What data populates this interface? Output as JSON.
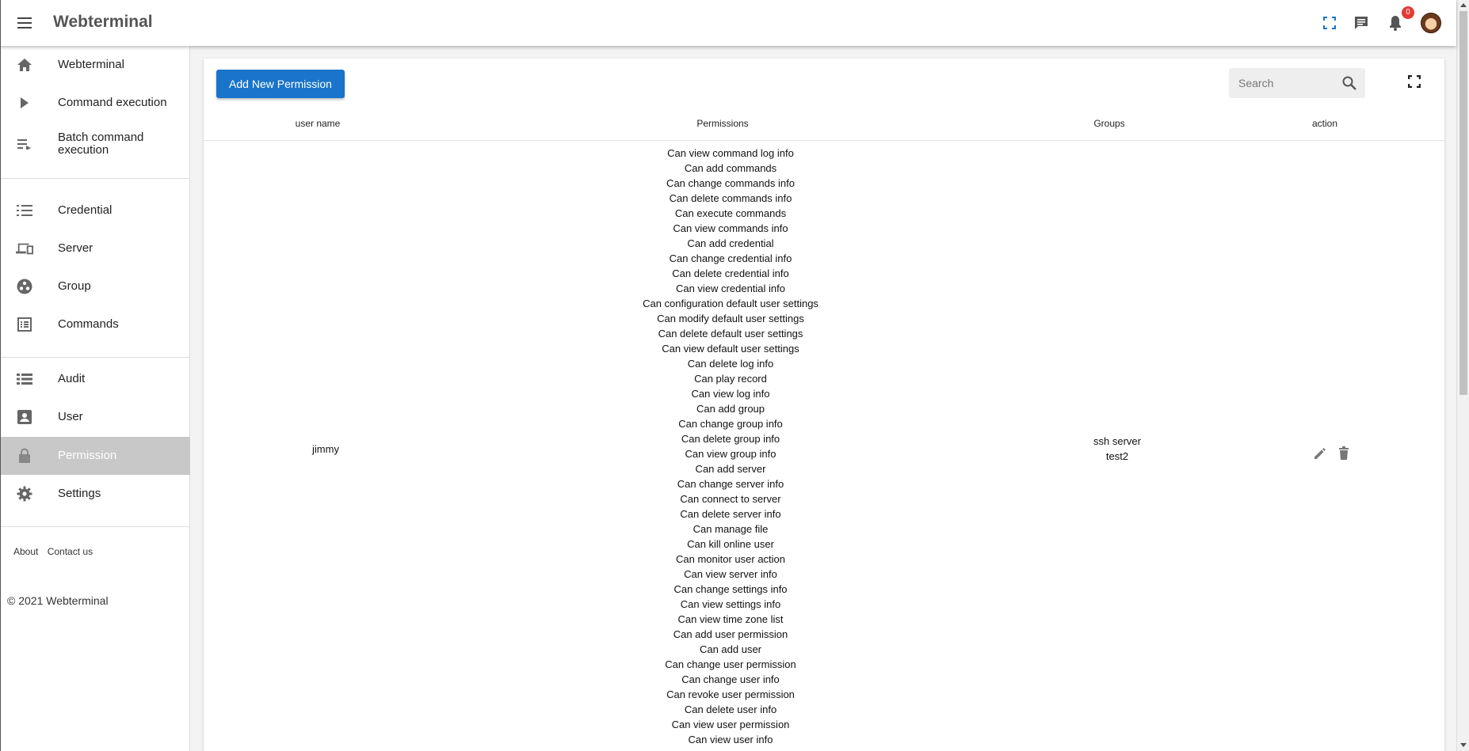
{
  "app": {
    "title": "Webterminal"
  },
  "topbar": {
    "notification_count": "0"
  },
  "sidebar": {
    "items": [
      {
        "label": "Webterminal",
        "icon": "home-icon"
      },
      {
        "label": "Command execution",
        "icon": "play-icon"
      },
      {
        "label": "Batch command execution",
        "icon": "playlist-icon"
      },
      {
        "label": "Credential",
        "icon": "list-numbered-icon"
      },
      {
        "label": "Server",
        "icon": "devices-icon"
      },
      {
        "label": "Group",
        "icon": "group-workspaces-icon"
      },
      {
        "label": "Commands",
        "icon": "list-alt-icon"
      },
      {
        "label": "Audit",
        "icon": "view-list-icon"
      },
      {
        "label": "User",
        "icon": "account-box-icon"
      },
      {
        "label": "Permission",
        "icon": "lock-icon",
        "active": true
      },
      {
        "label": "Settings",
        "icon": "gear-icon"
      }
    ],
    "footer_links": [
      "About",
      "Contact us"
    ],
    "copyright": "© 2021 Webterminal"
  },
  "toolbar": {
    "add_button_label": "Add New Permission",
    "search_placeholder": "Search"
  },
  "table": {
    "columns": [
      "user name",
      "Permissions",
      "Groups",
      "action"
    ],
    "rows": [
      {
        "user_name": "jimmy",
        "permissions": [
          "Can view command log info",
          "Can add commands",
          "Can change commands info",
          "Can delete commands info",
          "Can execute commands",
          "Can view commands info",
          "Can add credential",
          "Can change credential info",
          "Can delete credential info",
          "Can view credential info",
          "Can configuration default user settings",
          "Can modify default user settings",
          "Can delete default user settings",
          "Can view default user settings",
          "Can delete log info",
          "Can play record",
          "Can view log info",
          "Can add group",
          "Can change group info",
          "Can delete group info",
          "Can view group info",
          "Can add server",
          "Can change server info",
          "Can connect to server",
          "Can delete server info",
          "Can manage file",
          "Can kill online user",
          "Can monitor user action",
          "Can view server info",
          "Can change settings info",
          "Can view settings info",
          "Can view time zone list",
          "Can add user permission",
          "Can add user",
          "Can change user permission",
          "Can change user info",
          "Can revoke user permission",
          "Can delete user info",
          "Can view user permission",
          "Can view user info"
        ],
        "groups": [
          "ssh server",
          "test2"
        ]
      }
    ]
  },
  "colors": {
    "primary": "#1a74c9",
    "badge": "#e53935",
    "active_nav": "#c8c8c8"
  }
}
